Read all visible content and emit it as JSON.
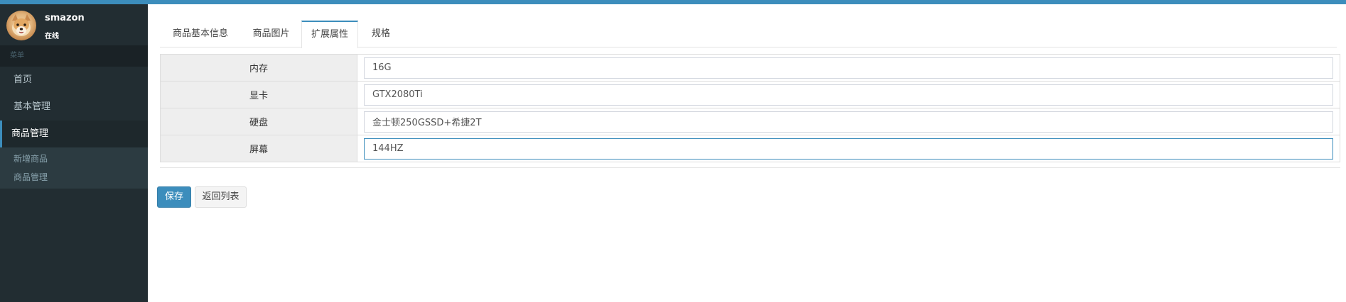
{
  "colors": {
    "accent": "#3c8dbc",
    "sidebar_bg": "#222d32",
    "sidebar_text": "#b8c7ce"
  },
  "user": {
    "name": "smazon",
    "status": "在线",
    "avatar_icon": "dog-avatar"
  },
  "sidebar": {
    "header": "菜单",
    "items": [
      {
        "label": "首页"
      },
      {
        "label": "基本管理"
      },
      {
        "label": "商品管理",
        "active": true
      }
    ],
    "submenu": [
      {
        "label": "新增商品"
      },
      {
        "label": "商品管理"
      }
    ]
  },
  "tabs": [
    {
      "label": "商品基本信息"
    },
    {
      "label": "商品图片"
    },
    {
      "label": "扩展属性",
      "active": true
    },
    {
      "label": "规格"
    }
  ],
  "attributes": [
    {
      "label": "内存",
      "value": "16G"
    },
    {
      "label": "显卡",
      "value": "GTX2080Ti"
    },
    {
      "label": "硬盘",
      "value": "金士顿250GSSD+希捷2T"
    },
    {
      "label": "屏幕",
      "value": "144HZ",
      "focused": true
    }
  ],
  "buttons": {
    "save": "保存",
    "back": "返回列表"
  }
}
